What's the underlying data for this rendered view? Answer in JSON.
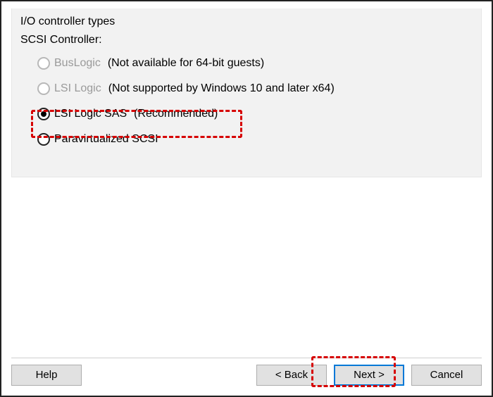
{
  "panel": {
    "title": "I/O controller types",
    "subtitle": "SCSI Controller:"
  },
  "options": {
    "bus_logic": {
      "label": "BusLogic",
      "hint": "(Not available for 64-bit guests)"
    },
    "lsi_logic": {
      "label": "LSI Logic",
      "hint": "(Not supported by Windows 10 and later x64)"
    },
    "lsi_logic_sas": {
      "label": "LSI Logic SAS",
      "hint": "(Recommended)"
    },
    "paravirtualized": {
      "label": "Paravirtualized SCSI",
      "hint": ""
    }
  },
  "buttons": {
    "help": "Help",
    "back": "< Back",
    "next": "Next >",
    "cancel": "Cancel"
  }
}
